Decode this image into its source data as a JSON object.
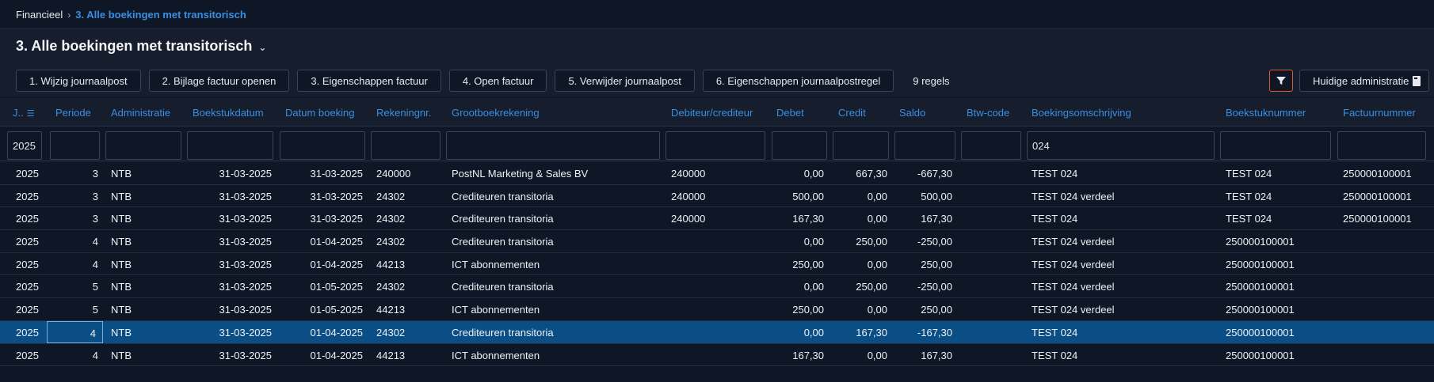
{
  "breadcrumb": {
    "root": "Financieel",
    "separator": "›",
    "current": "3. Alle boekingen met transitorisch"
  },
  "page": {
    "title": "3. Alle boekingen met transitorisch",
    "title_chevron": "⌄"
  },
  "toolbar": {
    "buttons": [
      "1. Wijzig journaalpost",
      "2. Bijlage factuur openen",
      "3. Eigenschappen factuur",
      "4. Open factuur",
      "5. Verwijder journaalpost",
      "6. Eigenschappen journaalpostregel"
    ],
    "row_count": "9 regels",
    "filter_icon": "filter-icon",
    "admin_label": "Huidige administratie",
    "admin_icon": "document-icon"
  },
  "columns": {
    "jaar": "J..",
    "periode": "Periode",
    "administratie": "Administratie",
    "boekstukdatum": "Boekstukdatum",
    "datum_boeking": "Datum boeking",
    "rekeningnr": "Rekeningnr.",
    "grootboekrekening": "Grootboekrekening",
    "debiteur": "Debiteur/crediteur",
    "debet": "Debet",
    "credit": "Credit",
    "saldo": "Saldo",
    "btw": "Btw-code",
    "omschrijving": "Boekingsomschrijving",
    "boekstuknummer": "Boekstuknummer",
    "factuurnummer": "Factuurnummer"
  },
  "filters": {
    "jaar": "2025",
    "omschrijving": "024"
  },
  "rows": [
    {
      "jaar": "2025",
      "periode": "3",
      "adm": "NTB",
      "bsd": "31-03-2025",
      "db": "31-03-2025",
      "rek": "240000",
      "gb": "PostNL Marketing & Sales BV",
      "deb": "240000",
      "debet": "0,00",
      "credit": "667,30",
      "saldo": "-667,30",
      "btw": "",
      "oms": "TEST 024",
      "bsn": "TEST 024",
      "fn": "250000100001"
    },
    {
      "jaar": "2025",
      "periode": "3",
      "adm": "NTB",
      "bsd": "31-03-2025",
      "db": "31-03-2025",
      "rek": "24302",
      "gb": "Crediteuren transitoria",
      "deb": "240000",
      "debet": "500,00",
      "credit": "0,00",
      "saldo": "500,00",
      "btw": "",
      "oms": "TEST 024 verdeel",
      "bsn": "TEST 024",
      "fn": "250000100001"
    },
    {
      "jaar": "2025",
      "periode": "3",
      "adm": "NTB",
      "bsd": "31-03-2025",
      "db": "31-03-2025",
      "rek": "24302",
      "gb": "Crediteuren transitoria",
      "deb": "240000",
      "debet": "167,30",
      "credit": "0,00",
      "saldo": "167,30",
      "btw": "",
      "oms": "TEST 024",
      "bsn": "TEST 024",
      "fn": "250000100001"
    },
    {
      "jaar": "2025",
      "periode": "4",
      "adm": "NTB",
      "bsd": "31-03-2025",
      "db": "01-04-2025",
      "rek": "24302",
      "gb": "Crediteuren transitoria",
      "deb": "",
      "debet": "0,00",
      "credit": "250,00",
      "saldo": "-250,00",
      "btw": "",
      "oms": "TEST 024 verdeel",
      "bsn": "250000100001",
      "fn": ""
    },
    {
      "jaar": "2025",
      "periode": "4",
      "adm": "NTB",
      "bsd": "31-03-2025",
      "db": "01-04-2025",
      "rek": "44213",
      "gb": "ICT abonnementen",
      "deb": "",
      "debet": "250,00",
      "credit": "0,00",
      "saldo": "250,00",
      "btw": "",
      "oms": "TEST 024 verdeel",
      "bsn": "250000100001",
      "fn": ""
    },
    {
      "jaar": "2025",
      "periode": "5",
      "adm": "NTB",
      "bsd": "31-03-2025",
      "db": "01-05-2025",
      "rek": "24302",
      "gb": "Crediteuren transitoria",
      "deb": "",
      "debet": "0,00",
      "credit": "250,00",
      "saldo": "-250,00",
      "btw": "",
      "oms": "TEST 024 verdeel",
      "bsn": "250000100001",
      "fn": ""
    },
    {
      "jaar": "2025",
      "periode": "5",
      "adm": "NTB",
      "bsd": "31-03-2025",
      "db": "01-05-2025",
      "rek": "44213",
      "gb": "ICT abonnementen",
      "deb": "",
      "debet": "250,00",
      "credit": "0,00",
      "saldo": "250,00",
      "btw": "",
      "oms": "TEST 024 verdeel",
      "bsn": "250000100001",
      "fn": ""
    },
    {
      "jaar": "2025",
      "periode": "4",
      "adm": "NTB",
      "bsd": "31-03-2025",
      "db": "01-04-2025",
      "rek": "24302",
      "gb": "Crediteuren transitoria",
      "deb": "",
      "debet": "0,00",
      "credit": "167,30",
      "saldo": "-167,30",
      "btw": "",
      "oms": "TEST 024",
      "bsn": "250000100001",
      "fn": "",
      "selected": true
    },
    {
      "jaar": "2025",
      "periode": "4",
      "adm": "NTB",
      "bsd": "31-03-2025",
      "db": "01-04-2025",
      "rek": "44213",
      "gb": "ICT abonnementen",
      "deb": "",
      "debet": "167,30",
      "credit": "0,00",
      "saldo": "167,30",
      "btw": "",
      "oms": "TEST 024",
      "bsn": "250000100001",
      "fn": ""
    }
  ],
  "colors": {
    "accent": "#3a8fe0",
    "selected_row": "#0b4e86",
    "filter_active": "#e05a2b",
    "background": "#0f1726"
  }
}
